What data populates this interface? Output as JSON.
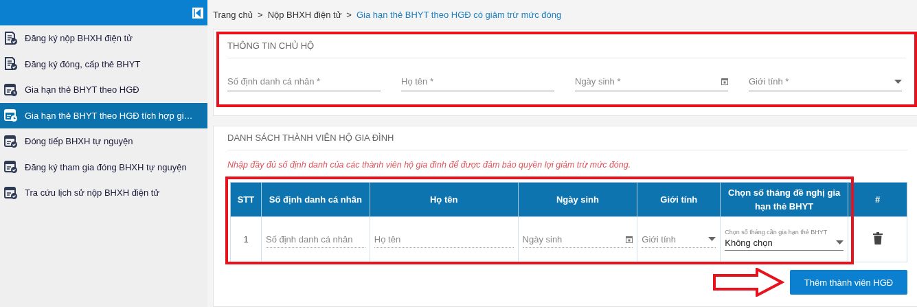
{
  "sidebar": {
    "items": [
      {
        "label": "Đăng ký nộp BHXH điện tử",
        "kind": "document",
        "selected": false
      },
      {
        "label": "Đăng ký đóng, cấp thẻ BHYT",
        "kind": "document",
        "selected": false
      },
      {
        "label": "Gia hạn thẻ BHYT theo HGĐ",
        "kind": "clock",
        "selected": false
      },
      {
        "label": "Gia hạn thẻ BHYT theo HGĐ tích hợp gi…",
        "kind": "clock",
        "selected": true
      },
      {
        "label": "Đóng tiếp BHXH tự nguyện",
        "kind": "check",
        "selected": false
      },
      {
        "label": "Đăng ký tham gia đóng BHXH tự nguyện",
        "kind": "check",
        "selected": false
      },
      {
        "label": "Tra cứu lịch sử nộp BHXH điện tử",
        "kind": "check",
        "selected": false
      }
    ]
  },
  "breadcrumb": [
    {
      "label": "Trang chủ",
      "selected": false
    },
    {
      "label": "Nộp BHXH điện tử",
      "selected": false
    },
    {
      "label": "Gia hạn thẻ BHYT theo HGĐ có giảm trừ mức đóng",
      "selected": true
    }
  ],
  "breadcrumb_separator": ">",
  "owner_section": {
    "title": "THÔNG TIN CHỦ HỘ",
    "fields": [
      {
        "placeholder": "Số định danh cá nhân *",
        "kind": "text"
      },
      {
        "placeholder": "Họ tên *",
        "kind": "text"
      },
      {
        "placeholder": "Ngày sinh *",
        "kind": "date"
      },
      {
        "placeholder": "Giới tính *",
        "kind": "select"
      }
    ]
  },
  "members_section": {
    "title": "DANH SÁCH THÀNH VIÊN HỘ GIA ĐÌNH",
    "note": "Nhập đầy đủ số định danh của các thành viên hộ gia đình để được đảm bảo quyền lợi giảm trừ mức đóng.",
    "table": {
      "columns": [
        "STT",
        "Số định danh cá nhân",
        "Họ tên",
        "Ngày sinh",
        "Giới tính",
        "Chọn số tháng đề nghị gia hạn thẻ BHYT",
        "#"
      ],
      "rows": [
        {
          "stt": "1",
          "id_placeholder": "Số định danh cá nhân",
          "name_placeholder": "Họ tên",
          "birth_placeholder": "Ngày sinh",
          "gender_placeholder": "Giới tính",
          "months_label": "Chọn số tháng cần gia hạn thẻ BHYT",
          "months_value": "Không chọn"
        }
      ]
    },
    "add_button": "Thêm thành viên HGĐ"
  }
}
